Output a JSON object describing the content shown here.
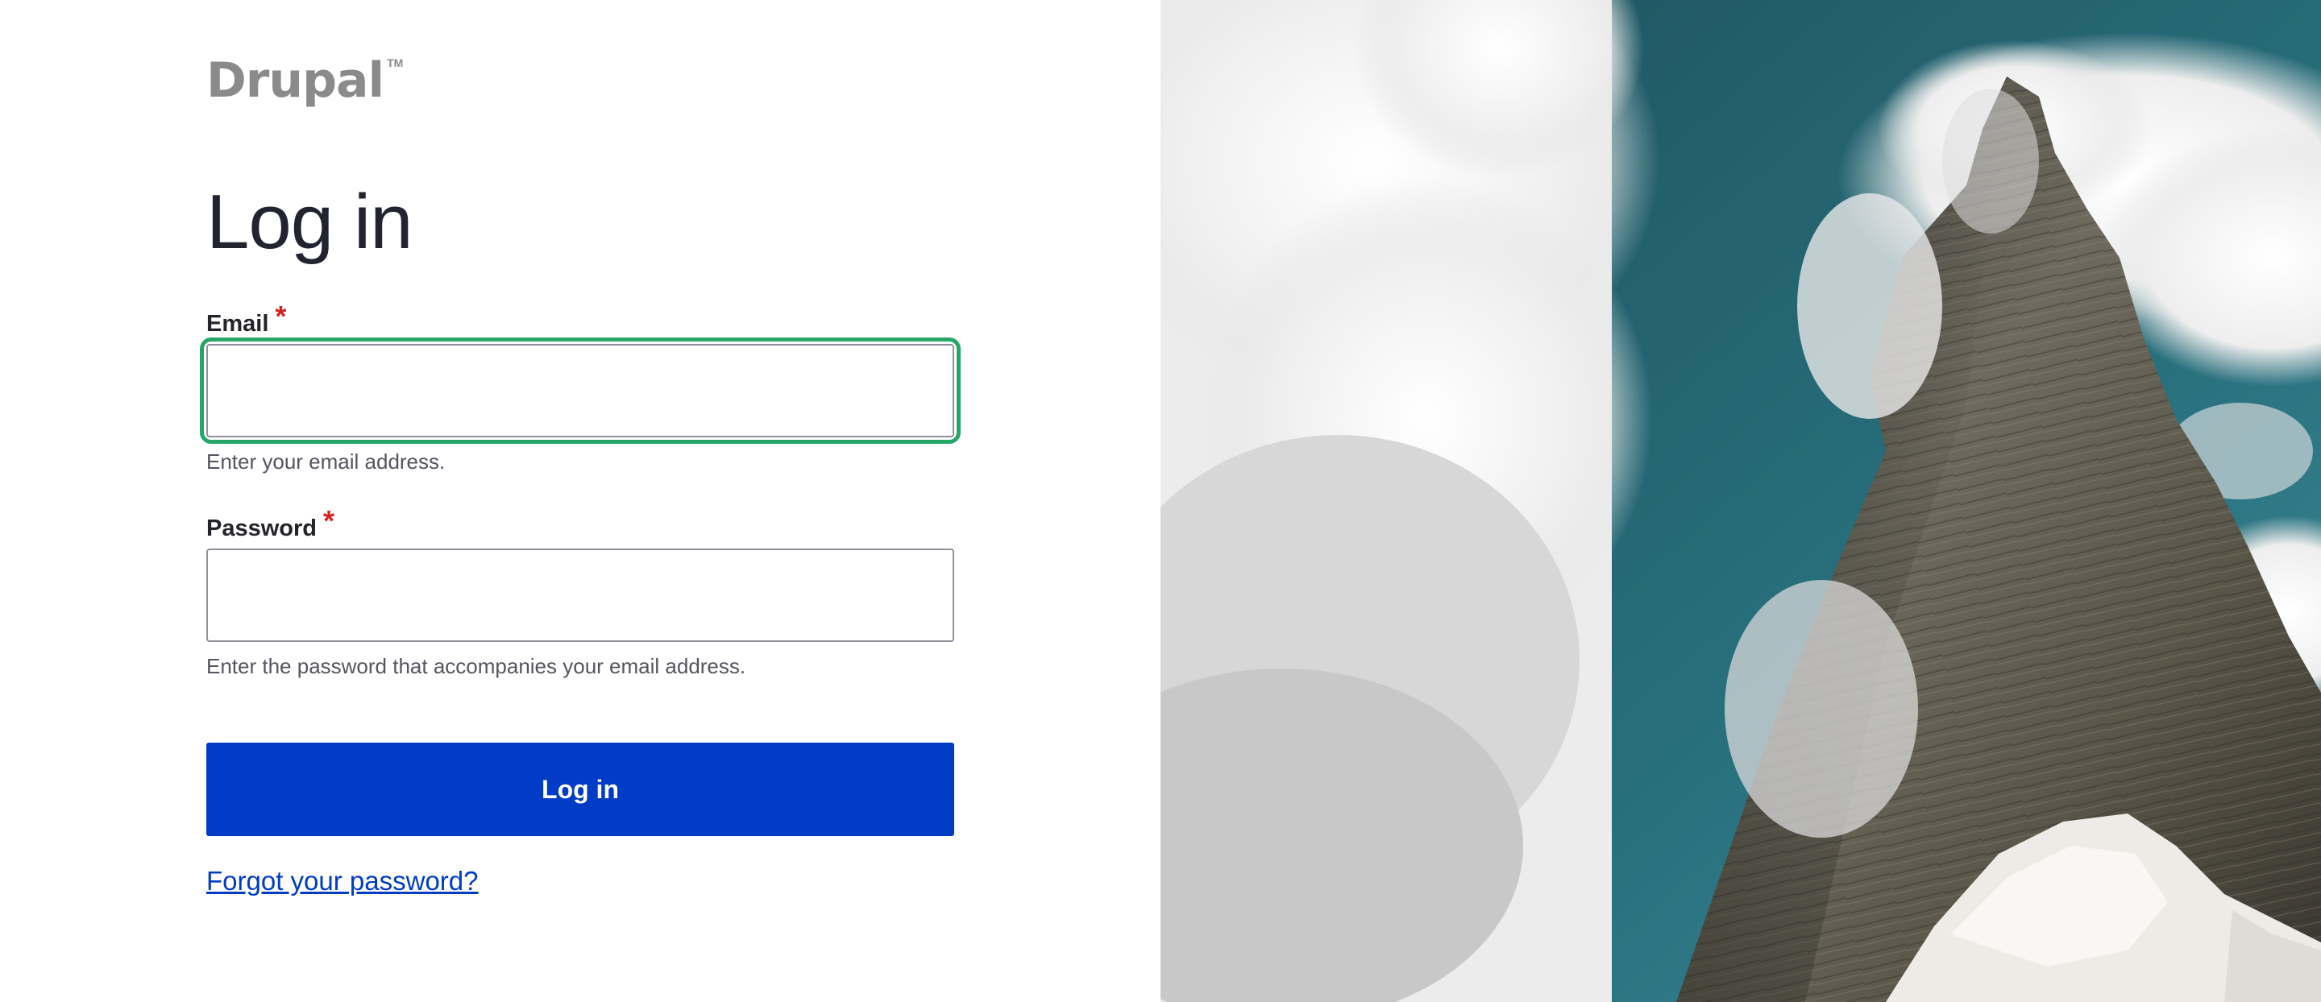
{
  "brand": {
    "name": "Drupal",
    "trademark": "TM"
  },
  "page_title": "Log in",
  "form": {
    "email": {
      "label": "Email",
      "required_mark": "*",
      "value": "",
      "description": "Enter your email address."
    },
    "password": {
      "label": "Password",
      "required_mark": "*",
      "value": "",
      "description": "Enter the password that accompanies your email address."
    },
    "submit_label": "Log in",
    "forgot_password_link": "Forgot your password?"
  },
  "colors": {
    "primary": "#003cc5",
    "focus_ring": "#26a769",
    "required": "#d72222",
    "sky": "#1f5a66"
  },
  "hero_image": {
    "subject": "mountain-peak-with-clouds-image"
  }
}
